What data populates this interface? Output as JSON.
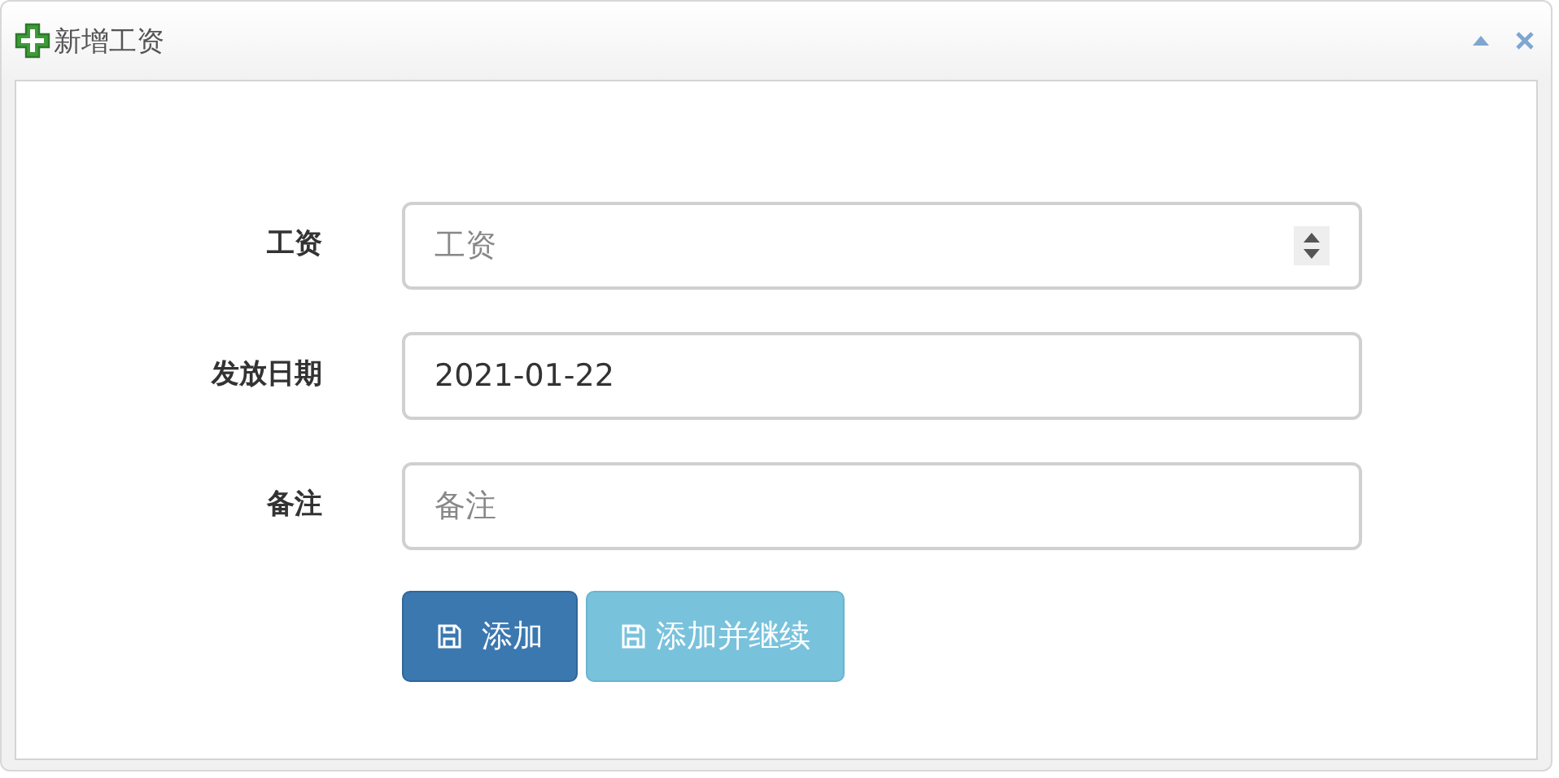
{
  "window": {
    "title": "新增工资"
  },
  "fields": [
    {
      "label": "工资",
      "kind": "number",
      "placeholder": "工资"
    },
    {
      "label": "发放日期",
      "kind": "date",
      "value": "2021-01-22"
    },
    {
      "label": "备注",
      "kind": "text",
      "placeholder": "备注"
    }
  ],
  "buttons": [
    {
      "label": "添加",
      "kind": "primary"
    },
    {
      "label": "添加并继续",
      "kind": "info"
    }
  ]
}
